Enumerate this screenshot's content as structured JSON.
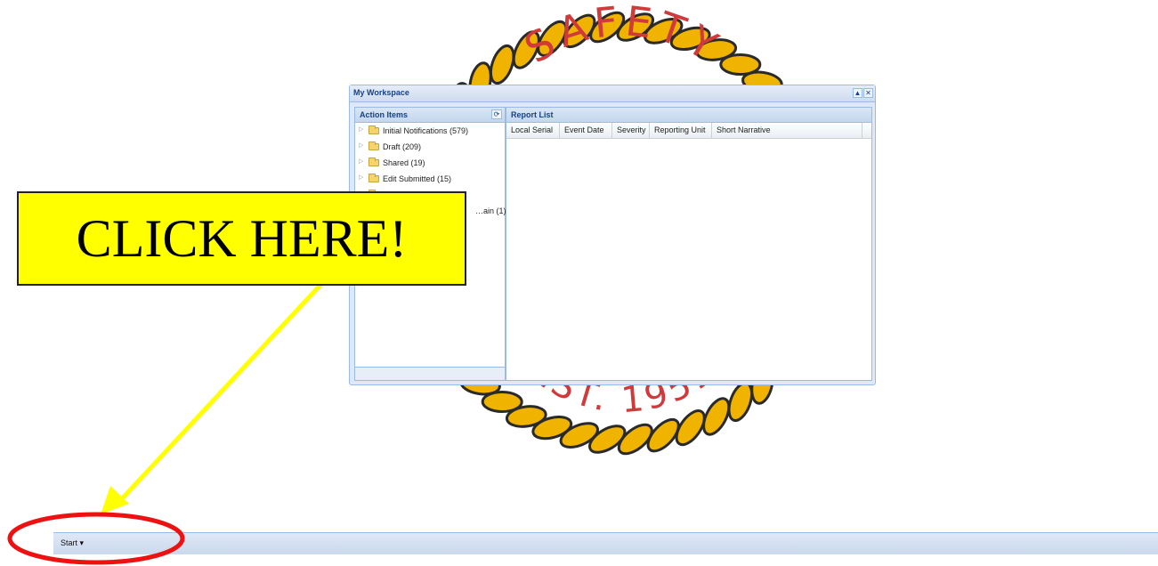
{
  "seal": {
    "top_text": "SAFETY",
    "bottom_text": "EST. 1951",
    "colors": {
      "rope": "#f0b400",
      "rope_outline": "#2a2a2a",
      "text": "#d13a3a"
    }
  },
  "window": {
    "title": "My Workspace",
    "buttons": {
      "collapse_icon": "▲",
      "close_icon": "✕"
    },
    "action_items": {
      "title": "Action Items",
      "refresh_icon": "⟳",
      "nodes": [
        {
          "label": "Initial Notifications (579)",
          "icon": "folder-icon"
        },
        {
          "label": "Draft (209)",
          "icon": "folder-icon"
        },
        {
          "label": "Shared (19)",
          "icon": "folder-icon"
        },
        {
          "label": "Edit Submitted (15)",
          "icon": "folder-icon"
        },
        {
          "label": "",
          "icon": "folder-icon"
        },
        {
          "label": "…ain (1)",
          "icon": "folder-icon"
        }
      ]
    },
    "report_list": {
      "title": "Report List",
      "columns": [
        "Local Serial",
        "Event Date",
        "Severity",
        "Reporting Unit",
        "Short Narrative"
      ]
    }
  },
  "taskbar": {
    "start_label": "Start ▾"
  },
  "annotation": {
    "callout_text": "CLICK HERE!",
    "colors": {
      "callout_bg": "#ffff00",
      "arrow": "#ffff00",
      "circle": "#ee1111"
    }
  }
}
